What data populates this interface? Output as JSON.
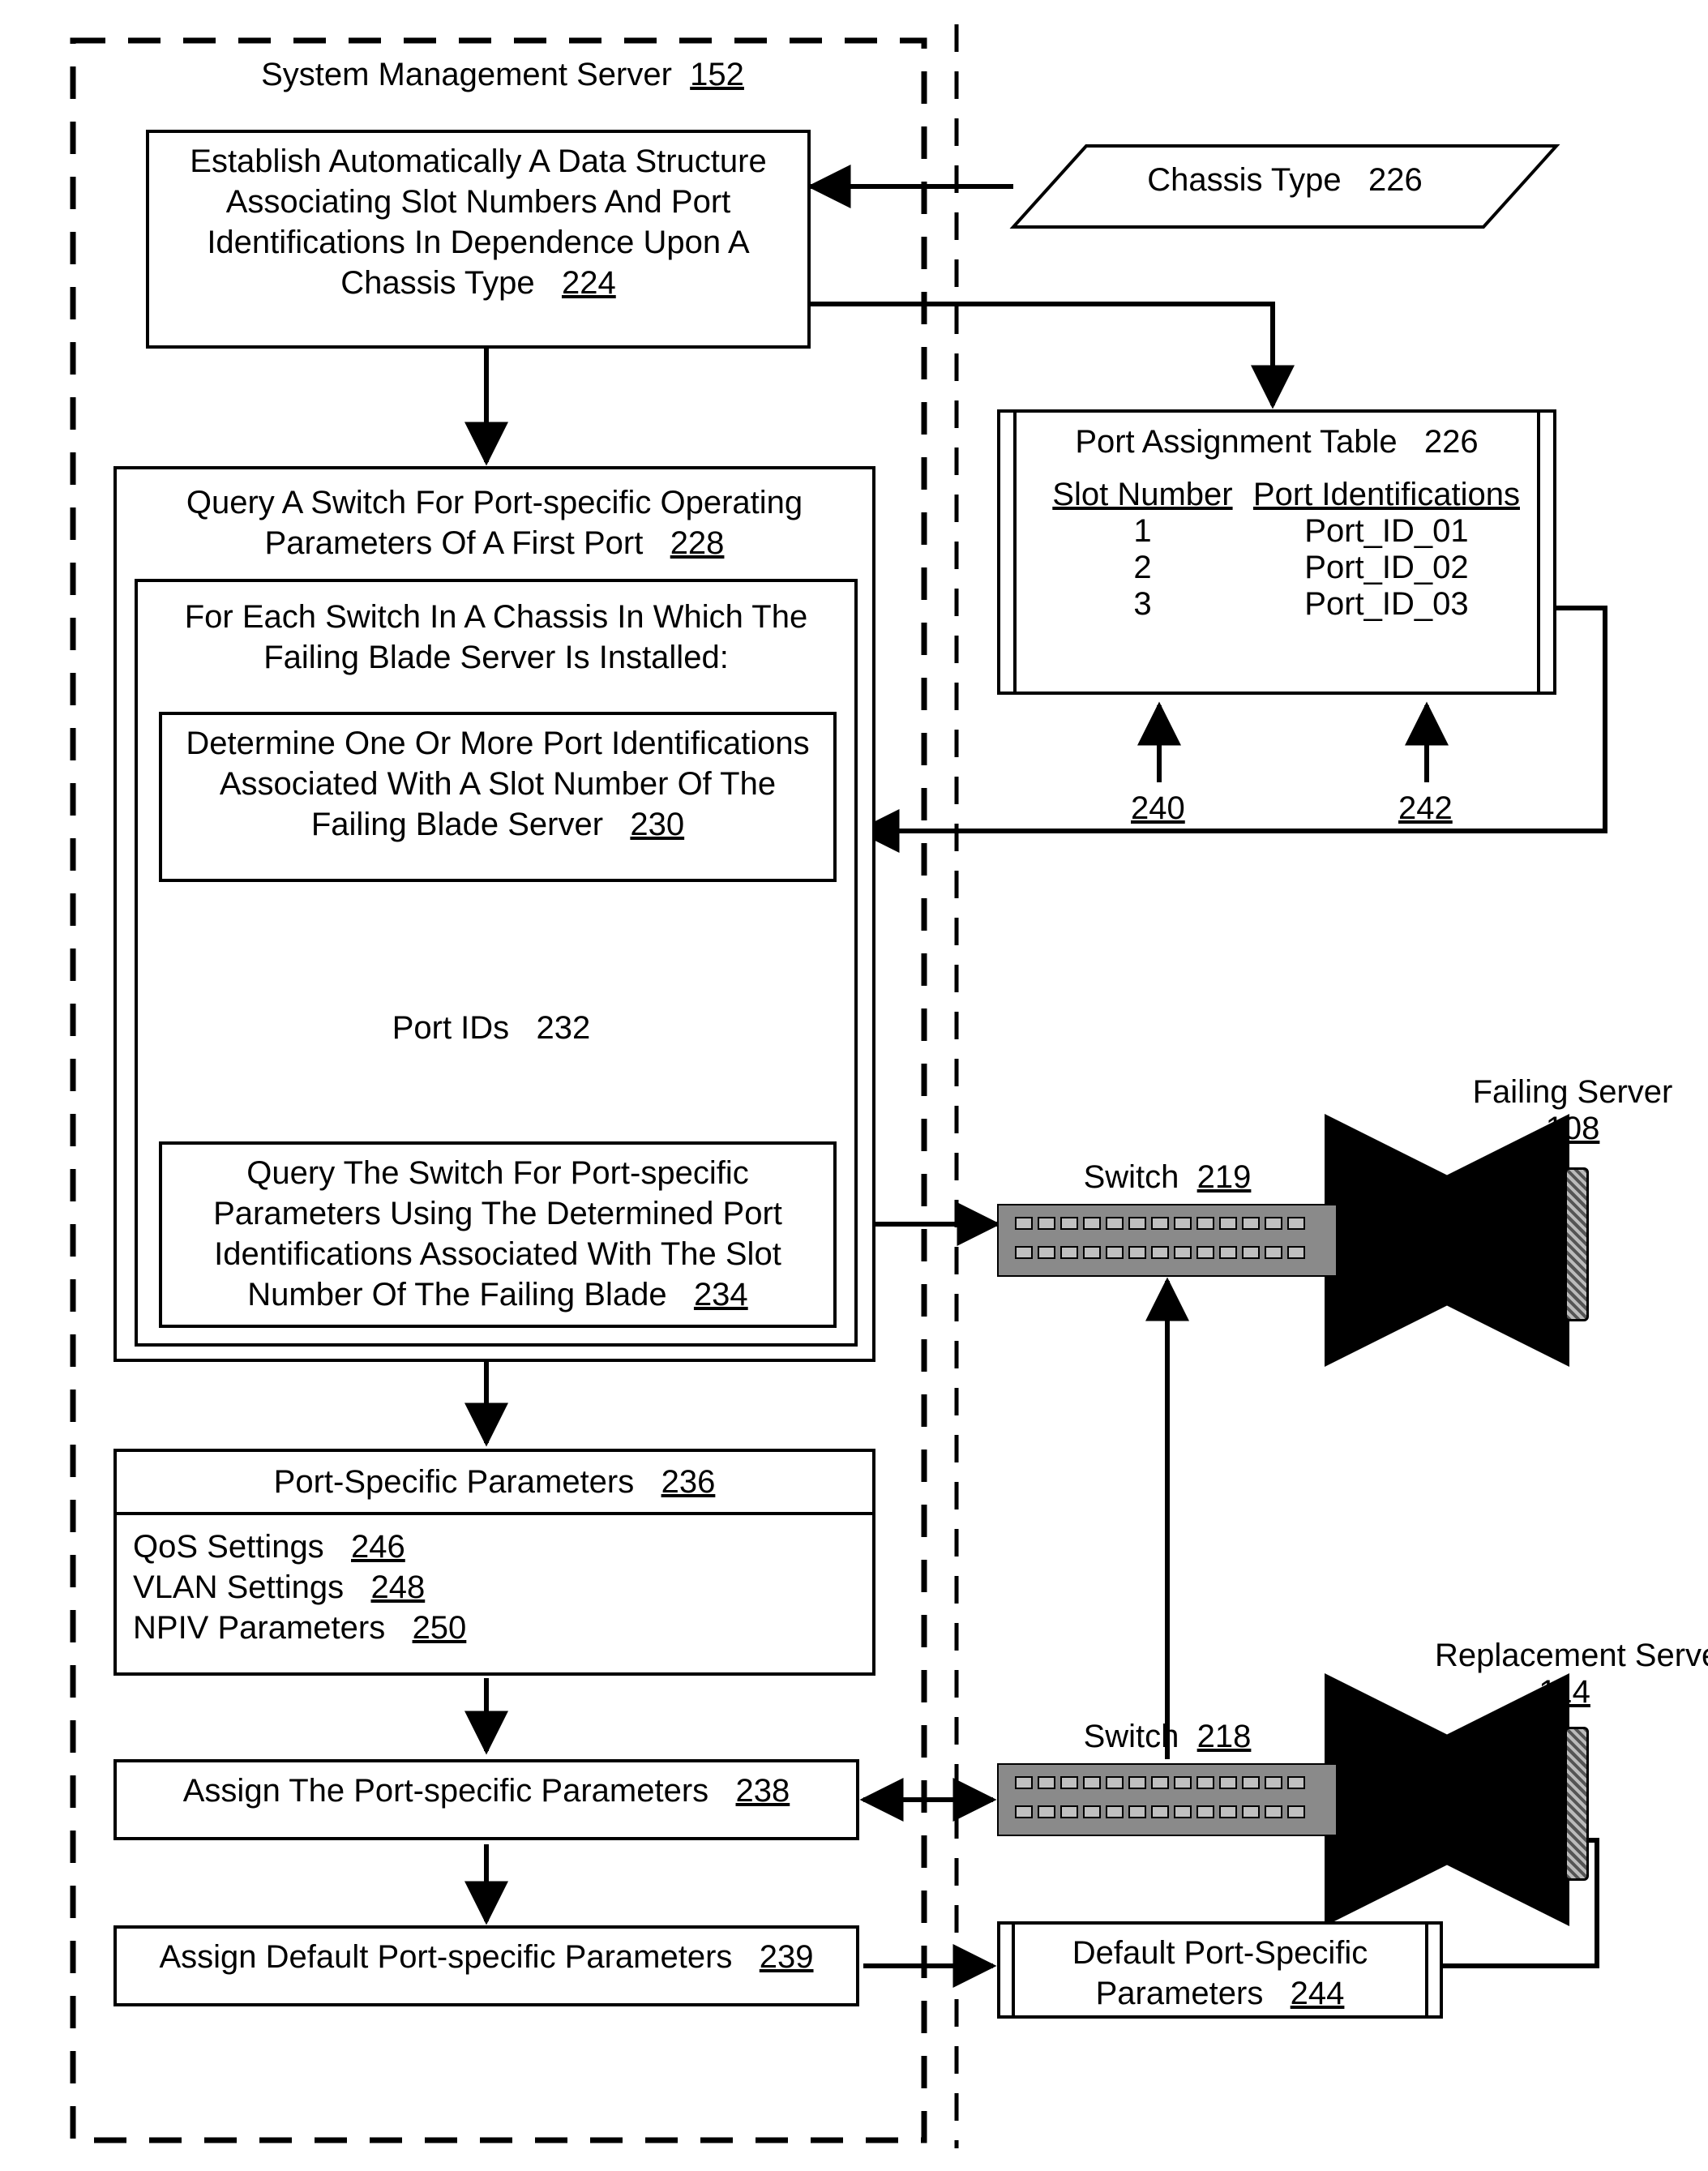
{
  "sms": {
    "title": "System Management Server",
    "ref": "152"
  },
  "box224": {
    "text": "Establish Automatically A Data Structure Associating Slot Numbers And Port Identifications In Dependence Upon A Chassis Type",
    "ref": "224"
  },
  "chassisType": {
    "text": "Chassis Type",
    "ref": "226"
  },
  "portTable": {
    "title": "Port Assignment Table",
    "ref": "226",
    "colSlot": "Slot Number",
    "colPort": "Port Identifications",
    "rows": [
      {
        "slot": "1",
        "port": "Port_ID_01"
      },
      {
        "slot": "2",
        "port": "Port_ID_02"
      },
      {
        "slot": "3",
        "port": "Port_ID_03"
      }
    ],
    "arrow240": "240",
    "arrow242": "242"
  },
  "box228": {
    "text": "Query A Switch For Port-specific Operating Parameters Of A First Port",
    "ref": "228"
  },
  "eachSwitch": "For Each Switch In A Chassis In Which The Failing Blade Server Is Installed:",
  "box230": {
    "text": "Determine One Or More Port Identifications Associated With A Slot Number Of The Failing Blade Server",
    "ref": "230"
  },
  "portIds": {
    "text": "Port IDs",
    "ref": "232"
  },
  "box234": {
    "text": "Query The Switch For Port-specific Parameters Using The Determined Port Identifications Associated With The Slot Number Of The Failing Blade",
    "ref": "234"
  },
  "box236": {
    "title": "Port-Specific Parameters",
    "ref": "236",
    "qos": {
      "t": "QoS Settings",
      "r": "246"
    },
    "vlan": {
      "t": "VLAN Settings",
      "r": "248"
    },
    "npiv": {
      "t": "NPIV Parameters",
      "r": "250"
    }
  },
  "box238": {
    "text": "Assign The Port-specific Parameters",
    "ref": "238"
  },
  "box239": {
    "text": "Assign Default Port-specific Parameters",
    "ref": "239"
  },
  "box244": {
    "text": "Default Port-Specific Parameters",
    "ref": "244"
  },
  "switch219": {
    "text": "Switch",
    "ref": "219"
  },
  "switch218": {
    "text": "Switch",
    "ref": "218"
  },
  "failingServer": {
    "text": "Failing Server",
    "ref": "108"
  },
  "replacementServer": {
    "text": "Replacement Server",
    "ref": "114"
  }
}
